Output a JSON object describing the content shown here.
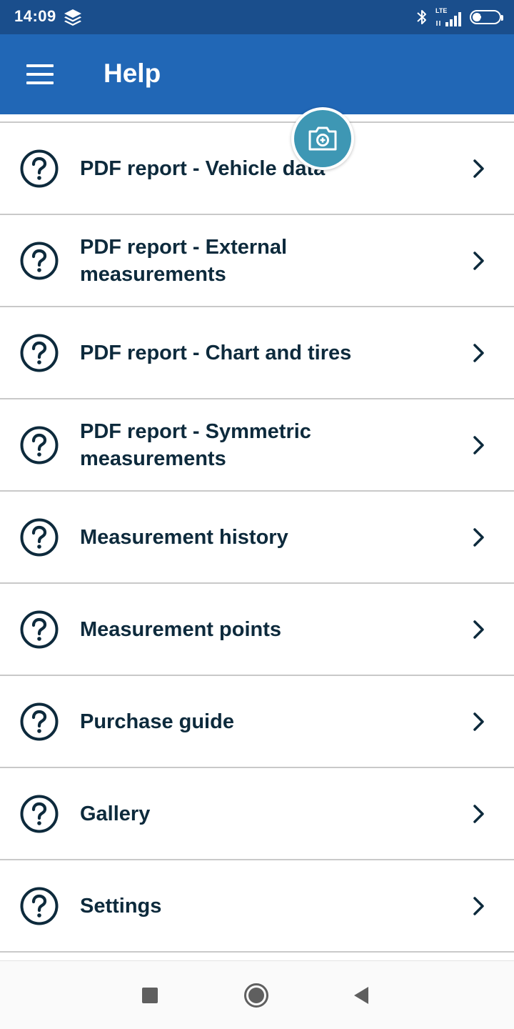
{
  "status_bar": {
    "time": "14:09",
    "network_label": "LTE",
    "battery_level": "32",
    "battery_fraction": 0.32
  },
  "app_bar": {
    "title": "Help"
  },
  "help_items": [
    {
      "label": "PDF report - Vehicle data"
    },
    {
      "label": "PDF report - External measurements"
    },
    {
      "label": "PDF report - Chart and tires"
    },
    {
      "label": "PDF report - Symmetric measurements"
    },
    {
      "label": "Measurement history"
    },
    {
      "label": "Measurement points"
    },
    {
      "label": "Purchase guide"
    },
    {
      "label": "Gallery"
    },
    {
      "label": "Settings"
    }
  ],
  "icons": {
    "menu": "hamburger-menu-icon",
    "help": "question-circle-icon",
    "chevron": "chevron-right-icon",
    "camera": "camera-icon",
    "layers": "layers-icon",
    "bluetooth": "bluetooth-icon",
    "signal": "signal-icon",
    "battery": "battery-icon"
  },
  "colors": {
    "status_bar": "#1a4e8c",
    "app_bar": "#2167b6",
    "text": "#0d2a3c",
    "divider": "#c9c9c9",
    "fab": "#3e97b4"
  }
}
